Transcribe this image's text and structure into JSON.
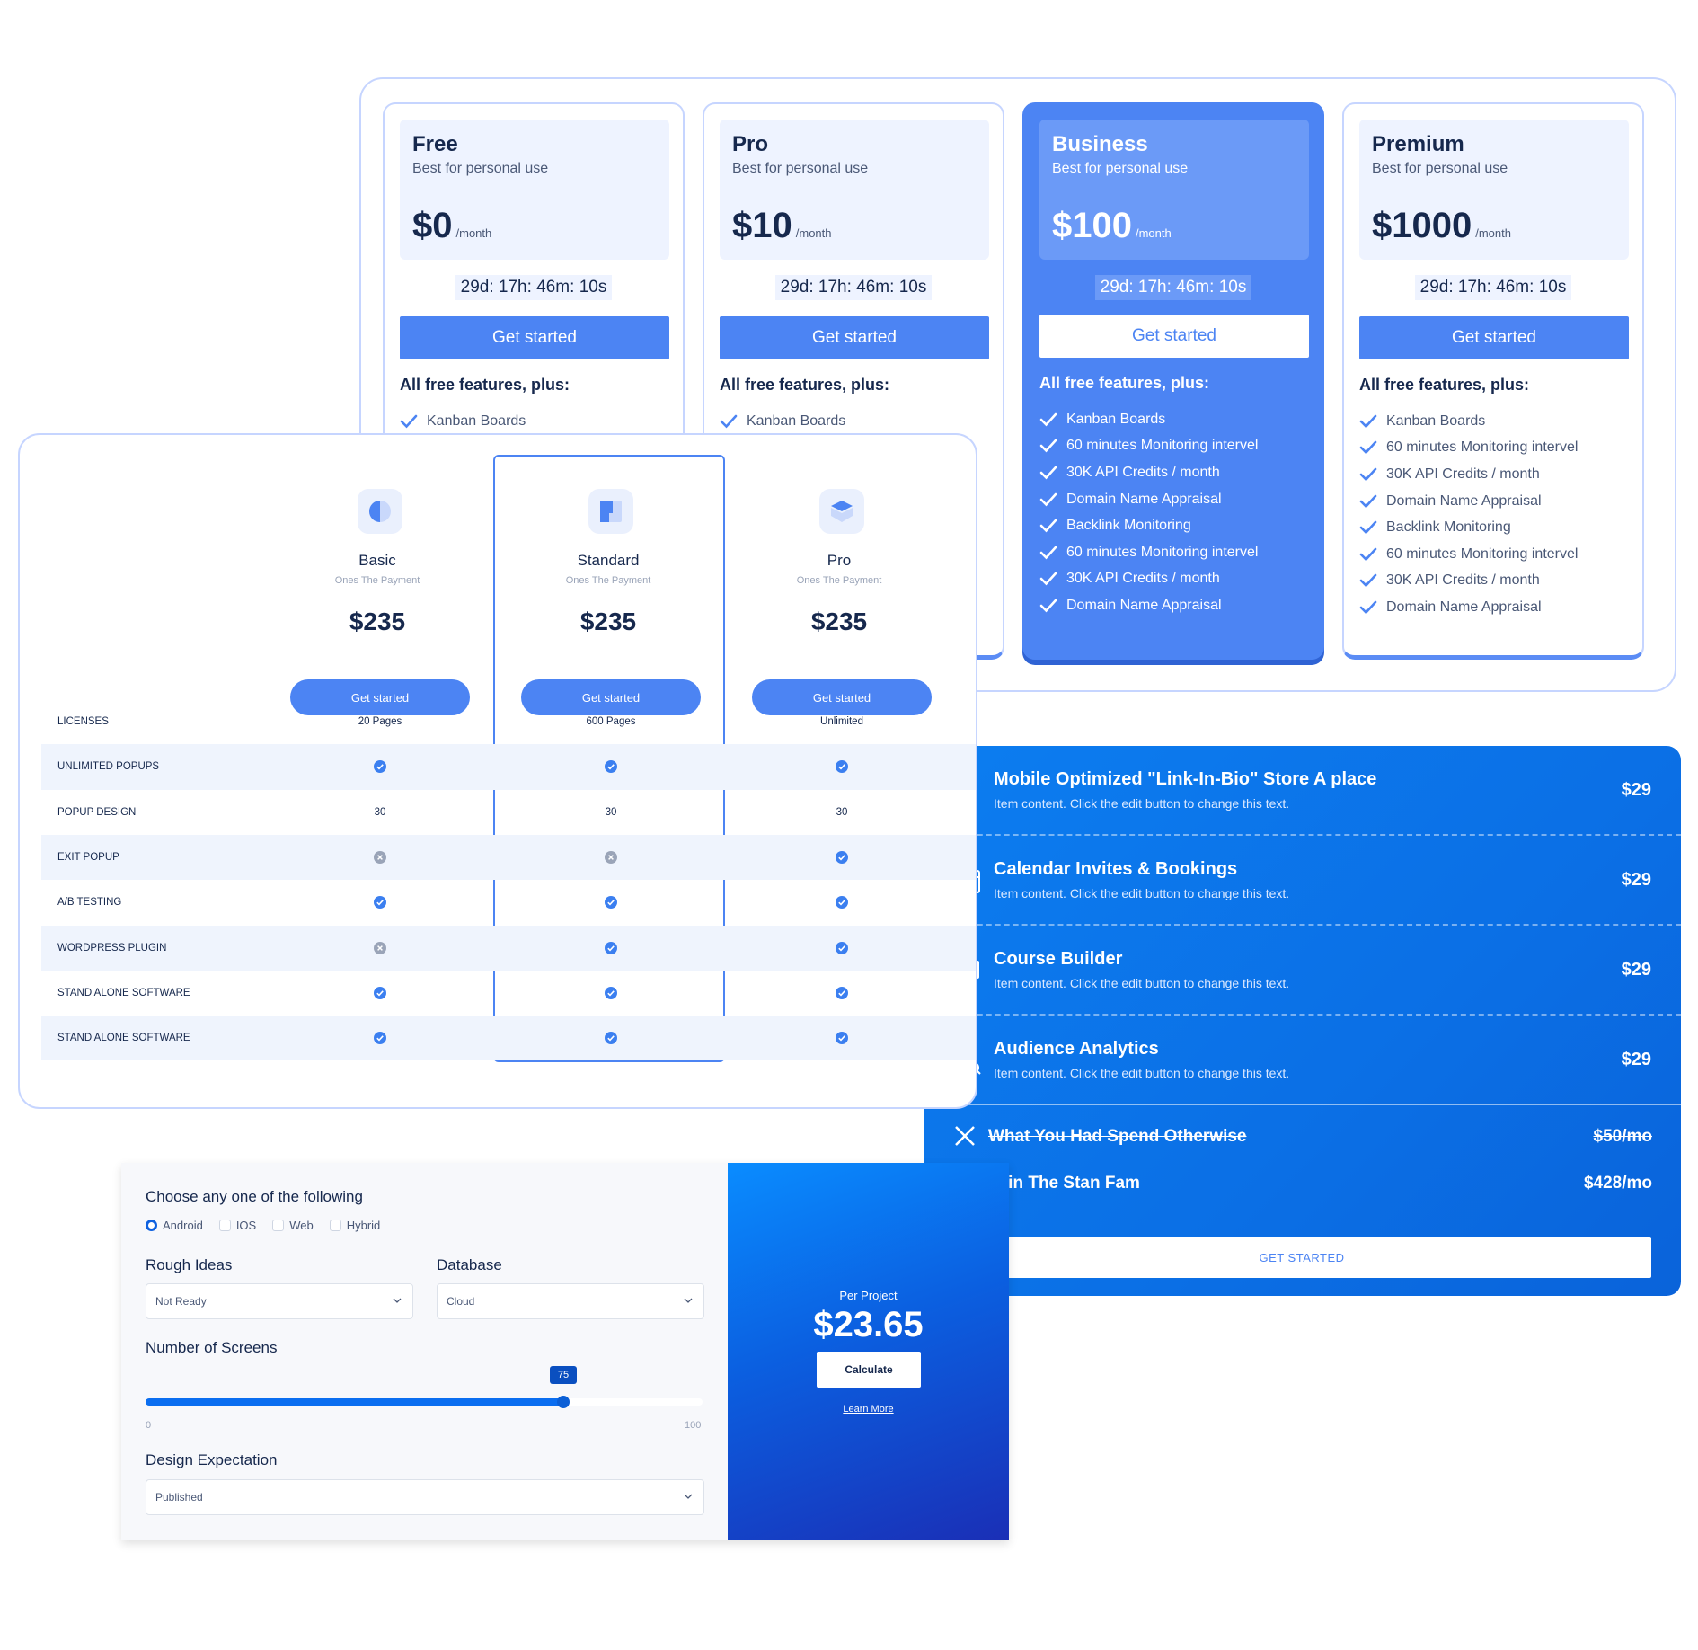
{
  "pricing_cards": [
    {
      "name": "Free",
      "subtitle": "Best for personal use",
      "price": "$0",
      "period": "/month",
      "timer": "29d: 17h: 46m: 10s",
      "button": "Get started",
      "features_heading": "All free features, plus:",
      "features": [
        "Kanban Boards"
      ]
    },
    {
      "name": "Pro",
      "subtitle": "Best for personal use",
      "price": "$10",
      "period": "/month",
      "timer": "29d: 17h: 46m: 10s",
      "button": "Get started",
      "features_heading": "All free features, plus:",
      "features": [
        "Kanban Boards"
      ]
    },
    {
      "name": "Business",
      "subtitle": "Best for personal use",
      "price": "$100",
      "period": "/month",
      "timer": "29d: 17h: 46m: 10s",
      "button": "Get started",
      "features_heading": "All free features, plus:",
      "features": [
        "Kanban Boards",
        "60 minutes Monitoring intervel",
        "30K API Credits / month",
        "Domain Name Appraisal",
        "Backlink Monitoring",
        "60 minutes Monitoring intervel",
        "30K API Credits / month",
        "Domain Name Appraisal"
      ]
    },
    {
      "name": "Premium",
      "subtitle": "Best for personal use",
      "price": "$1000",
      "period": "/month",
      "timer": "29d: 17h: 46m: 10s",
      "button": "Get started",
      "features_heading": "All free features, plus:",
      "features": [
        "Kanban Boards",
        "60 minutes Monitoring intervel",
        "30K API Credits / month",
        "Domain Name Appraisal",
        "Backlink Monitoring",
        "60 minutes Monitoring intervel",
        "30K API Credits / month",
        "Domain Name Appraisal"
      ]
    }
  ],
  "comparison": {
    "plans": [
      {
        "name": "Basic",
        "subtitle": "Ones The Payment",
        "price": "$235",
        "button": "Get started",
        "icon": "half-circle-icon"
      },
      {
        "name": "Standard",
        "subtitle": "Ones The Payment",
        "price": "$235",
        "button": "Get started",
        "icon": "layout-blocks-icon"
      },
      {
        "name": "Pro",
        "subtitle": "Ones The Payment",
        "price": "$235",
        "button": "Get started",
        "icon": "cube-icon"
      }
    ],
    "rows": [
      {
        "label": "LICENSES",
        "values": [
          "20 Pages",
          "600 Pages",
          "Unlimited"
        ]
      },
      {
        "label": "UNLIMITED POPUPS",
        "values": [
          "check",
          "check",
          "check"
        ]
      },
      {
        "label": "POPUP DESIGN",
        "values": [
          "30",
          "30",
          "30"
        ]
      },
      {
        "label": "EXIT POPUP",
        "values": [
          "cross",
          "cross",
          "check"
        ]
      },
      {
        "label": "A/B TESTING",
        "values": [
          "check",
          "check",
          "check"
        ]
      },
      {
        "label": "WORDPRESS PLUGIN",
        "values": [
          "cross",
          "check",
          "check"
        ]
      },
      {
        "label": "STAND ALONE SOFTWARE",
        "values": [
          "check",
          "check",
          "check"
        ]
      },
      {
        "label": "STAND ALONE SOFTWARE",
        "values": [
          "check",
          "check",
          "check"
        ]
      }
    ]
  },
  "configurator": {
    "choose_label": "Choose any one of the following",
    "options": [
      "Android",
      "IOS",
      "Web",
      "Hybrid"
    ],
    "selected_option": "Android",
    "rough_ideas": {
      "label": "Rough Ideas",
      "value": "Not Ready"
    },
    "database": {
      "label": "Database",
      "value": "Cloud"
    },
    "screens": {
      "label": "Number of Screens",
      "value": "75",
      "min": "0",
      "max": "100",
      "fraction": 0.75
    },
    "design": {
      "label": "Design Expectation",
      "value": "Published"
    },
    "result": {
      "label": "Per Project",
      "price": "$23.65",
      "button": "Calculate",
      "link": "Learn More"
    }
  },
  "features_panel": {
    "items": [
      {
        "title": "Mobile Optimized \"Link-In-Bio\" Store A place",
        "desc": "Item content. Click the edit button to change this text.",
        "price": "$29",
        "icon": "mobile-phone-icon"
      },
      {
        "title": "Calendar Invites & Bookings",
        "desc": "Item content. Click the edit button to change this text.",
        "price": "$29",
        "icon": "calendar-icon"
      },
      {
        "title": "Course Builder",
        "desc": "Item content. Click the edit button to change this text.",
        "price": "$29",
        "icon": "course-icon"
      },
      {
        "title": "Audience Analytics",
        "desc": "Item content. Click the edit button to change this text.",
        "price": "$29",
        "icon": "analytics-icon"
      }
    ],
    "otherwise": {
      "title": "What You Had Spend Otherwise",
      "price": "$50/mo",
      "icon": "close-x-icon"
    },
    "join": {
      "title": "Join The Stan Fam",
      "price": "$428/mo",
      "icon": "mobile-phone-icon"
    },
    "button": "GET STARTED"
  },
  "colors": {
    "primary": "#4c84f3",
    "accent_blue": "#0b6fe5",
    "check": "#3b7ff0",
    "cross": "#9aa4b8"
  }
}
